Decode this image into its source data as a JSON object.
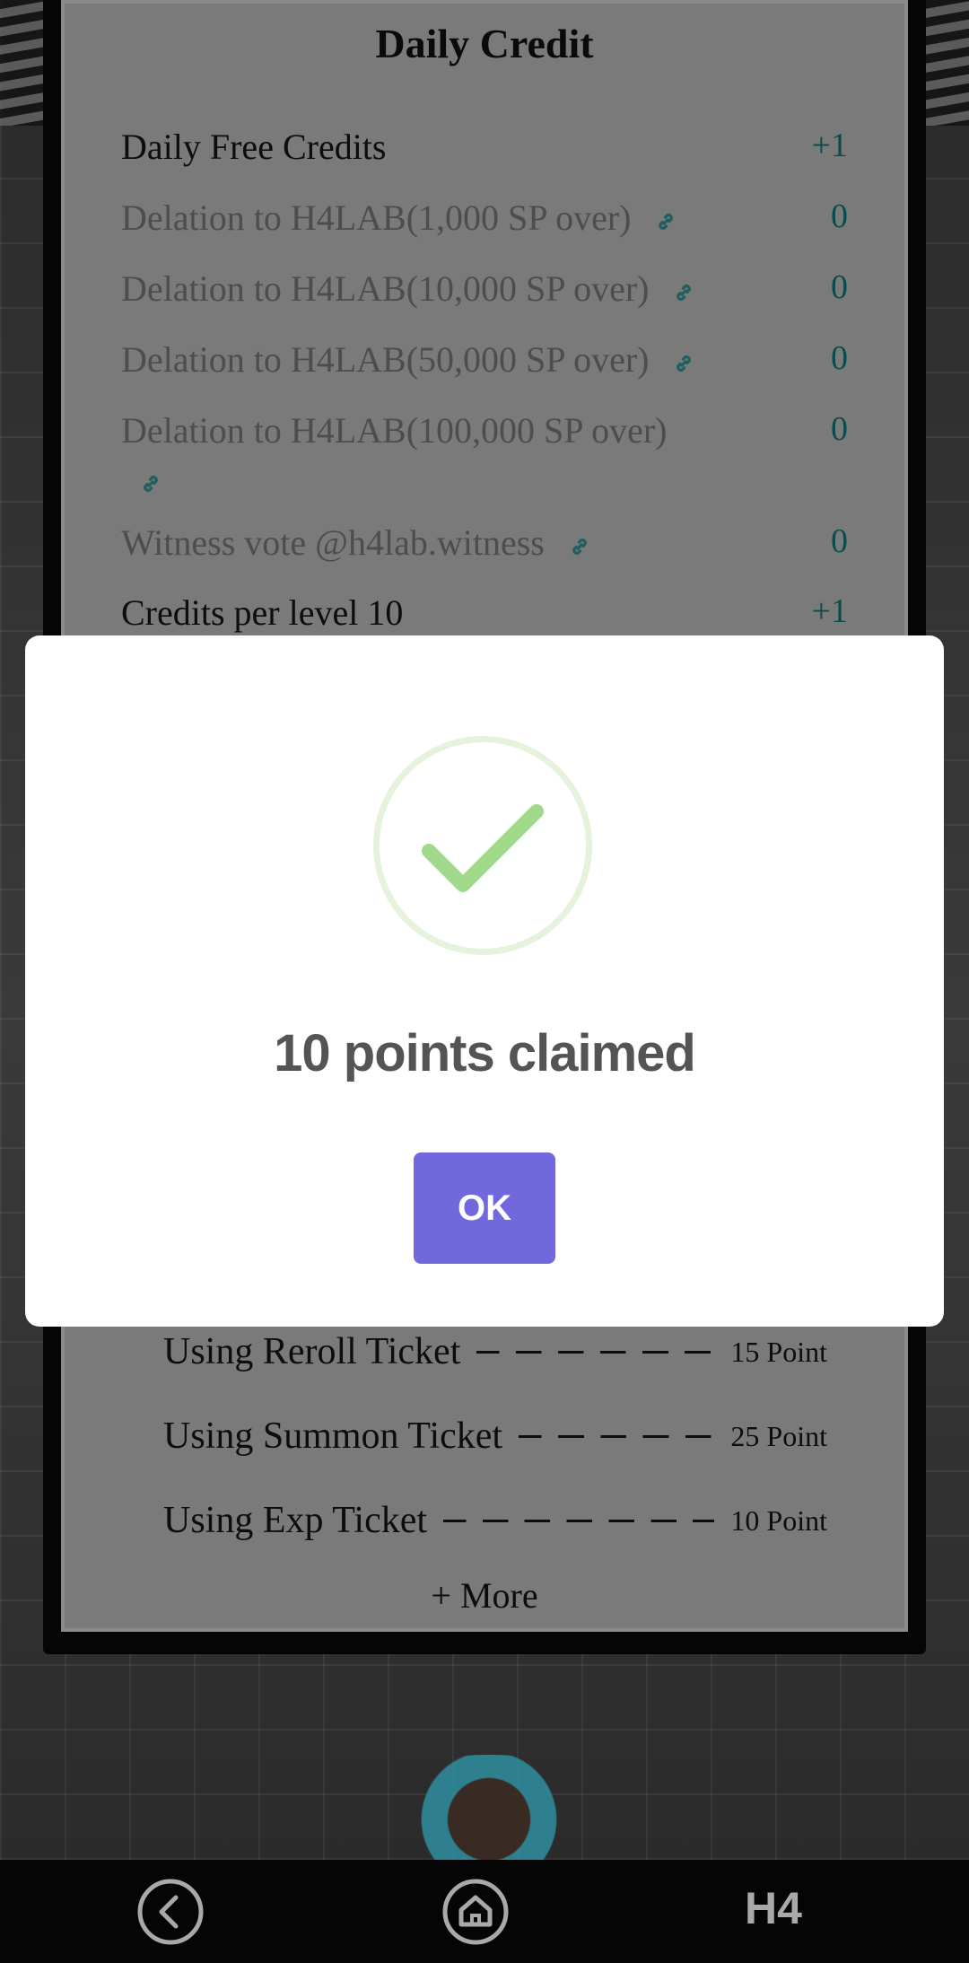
{
  "daily_credit": {
    "title": "Daily Credit",
    "rows": [
      {
        "label": "Daily Free Credits",
        "value": "+1",
        "link": false
      },
      {
        "label": "Delation to H4LAB(1,000 SP over)",
        "value": "0",
        "link": true
      },
      {
        "label": "Delation to H4LAB(10,000 SP over)",
        "value": "0",
        "link": true
      },
      {
        "label": "Delation to H4LAB(50,000 SP over)",
        "value": "0",
        "link": true
      },
      {
        "label": "Delation to H4LAB(100,000 SP over)",
        "value": "0",
        "link": true
      },
      {
        "label": "Witness vote @h4lab.witness",
        "value": "0",
        "link": true
      },
      {
        "label": "Credits per level 10",
        "value": "+1",
        "link": false
      }
    ]
  },
  "point_usage": {
    "rows": [
      {
        "label": "Using Reroll Ticket",
        "points": "15 Point"
      },
      {
        "label": "Using Summon Ticket",
        "points": "25 Point"
      },
      {
        "label": "Using Exp Ticket",
        "points": "10 Point"
      }
    ],
    "more_label": "+ More"
  },
  "modal": {
    "icon": "success-check-icon",
    "title": "10 points claimed",
    "ok_label": "OK",
    "colors": {
      "ring": "#e5f2dc",
      "check": "#a0d98a",
      "button": "#7168dd"
    }
  },
  "navbar": {
    "back_icon": "back-arrow-icon",
    "home_icon": "home-icon",
    "brand_label": "H4"
  }
}
